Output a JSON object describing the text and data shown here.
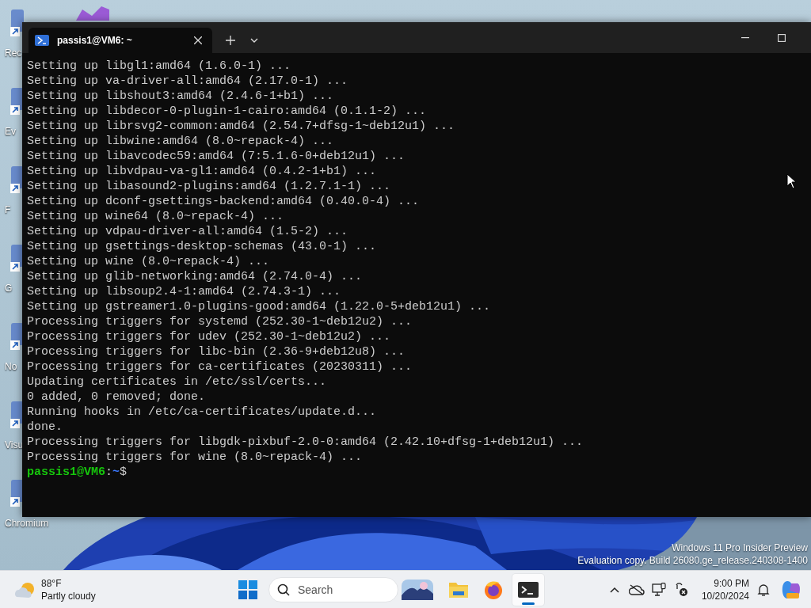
{
  "desktop": {
    "icons": [
      {
        "label": "Rec"
      },
      {
        "label": "Ev"
      },
      {
        "label": "F"
      },
      {
        "label": "G"
      },
      {
        "label": "No"
      },
      {
        "label": "Visu"
      },
      {
        "label": "Chromium"
      }
    ],
    "watermark": [
      "Windows 11 Pro Insider Preview",
      "Evaluation copy. Build 26080.ge_release.240308-1400"
    ]
  },
  "terminal": {
    "tab": {
      "title": "passis1@VM6: ~"
    },
    "lines": [
      "Setting up libgl1:amd64 (1.6.0-1) ...",
      "Setting up va-driver-all:amd64 (2.17.0-1) ...",
      "Setting up libshout3:amd64 (2.4.6-1+b1) ...",
      "Setting up libdecor-0-plugin-1-cairo:amd64 (0.1.1-2) ...",
      "Setting up librsvg2-common:amd64 (2.54.7+dfsg-1~deb12u1) ...",
      "Setting up libwine:amd64 (8.0~repack-4) ...",
      "Setting up libavcodec59:amd64 (7:5.1.6-0+deb12u1) ...",
      "Setting up libvdpau-va-gl1:amd64 (0.4.2-1+b1) ...",
      "Setting up libasound2-plugins:amd64 (1.2.7.1-1) ...",
      "Setting up dconf-gsettings-backend:amd64 (0.40.0-4) ...",
      "Setting up wine64 (8.0~repack-4) ...",
      "Setting up vdpau-driver-all:amd64 (1.5-2) ...",
      "Setting up gsettings-desktop-schemas (43.0-1) ...",
      "Setting up wine (8.0~repack-4) ...",
      "Setting up glib-networking:amd64 (2.74.0-4) ...",
      "Setting up libsoup2.4-1:amd64 (2.74.3-1) ...",
      "Setting up gstreamer1.0-plugins-good:amd64 (1.22.0-5+deb12u1) ...",
      "Processing triggers for systemd (252.30-1~deb12u2) ...",
      "Processing triggers for udev (252.30-1~deb12u2) ...",
      "Processing triggers for libc-bin (2.36-9+deb12u8) ...",
      "Processing triggers for ca-certificates (20230311) ...",
      "Updating certificates in /etc/ssl/certs...",
      "0 added, 0 removed; done.",
      "Running hooks in /etc/ca-certificates/update.d...",
      "done.",
      "Processing triggers for libgdk-pixbuf-2.0-0:amd64 (2.42.10+dfsg-1+deb12u1) ...",
      "Processing triggers for wine (8.0~repack-4) ..."
    ],
    "prompt": [
      {
        "kind": "host",
        "text": "passis1@VM6"
      },
      {
        "kind": "plain",
        "text": ":"
      },
      {
        "kind": "path",
        "text": "~"
      },
      {
        "kind": "plain",
        "text": "$"
      }
    ]
  },
  "taskbar": {
    "weather": {
      "temperature": "88°F",
      "condition": "Partly cloudy"
    },
    "search": {
      "placeholder": "Search"
    },
    "apps": [
      {
        "kind": "start",
        "selected": false
      },
      {
        "kind": "files",
        "selected": false
      },
      {
        "kind": "firefox",
        "selected": false
      },
      {
        "kind": "terminal",
        "selected": true
      }
    ],
    "clock": {
      "time": "9:00 PM",
      "date": "10/20/2024"
    }
  }
}
